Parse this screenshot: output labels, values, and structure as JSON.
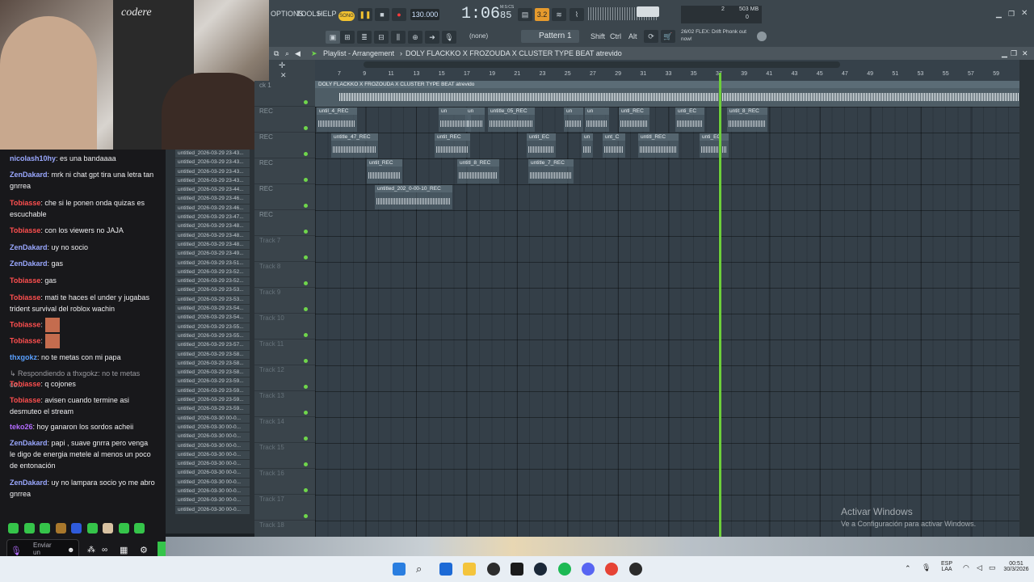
{
  "webcam": {
    "shirt_text": "codere"
  },
  "chat": {
    "messages": [
      {
        "user": "nicolash10hy",
        "color": "#9aa8ff",
        "text": ": es una bandaaaa"
      },
      {
        "user": "ZenDakard",
        "color": "#9aa8ff",
        "text": ": mrk ni chat gpt tira una letra tan gnrrea"
      },
      {
        "user": "Tobiasse",
        "color": "#ff4f4f",
        "text": ": che si le ponen onda quizas es escuchable"
      },
      {
        "user": "Tobiasse",
        "color": "#ff4f4f",
        "text": ": con los viewers no JAJA"
      },
      {
        "user": "ZenDakard",
        "color": "#9aa8ff",
        "text": ": uy no socio"
      },
      {
        "user": "ZenDakard",
        "color": "#9aa8ff",
        "text": ": gas"
      },
      {
        "user": "Tobiasse",
        "color": "#ff4f4f",
        "text": ": gas"
      },
      {
        "user": "Tobiasse",
        "color": "#ff4f4f",
        "text": ": mati te haces el under y jugabas trident survival del roblox wachin"
      },
      {
        "user": "Tobiasse",
        "color": "#ff4f4f",
        "text": ":"
      },
      {
        "user": "Tobiasse",
        "color": "#ff4f4f",
        "text": ":"
      },
      {
        "user": "thxgokz",
        "color": "#5aa0ff",
        "text": ": no te metas con mi papa"
      },
      {
        "user": "",
        "color": "#9a9aa0",
        "text": "↳ Respondiendo a thxgokz: no te metas co..."
      },
      {
        "user": "Tobiasse",
        "color": "#ff4f4f",
        "text": ": q cojones"
      },
      {
        "user": "Tobiasse",
        "color": "#ff4f4f",
        "text": ": avisen cuando termine asi desmuteo el stream"
      },
      {
        "user": "teko26",
        "color": "#b36cff",
        "text": ": hoy ganaron los sordos acheii"
      },
      {
        "user": "ZenDakard",
        "color": "#9aa8ff",
        "text": ": papi , suave gnrra pero venga le digo de energia metele al menos un poco de entonación"
      },
      {
        "user": "ZenDakard",
        "color": "#9aa8ff",
        "text": ": uy no lampara socio yo me abro gnrrea"
      }
    ],
    "send_label": "Enviar un mensaje"
  },
  "files": [
    "untitled_2026-03-29 23-43...",
    "untitled_2026-03-29 23-43...",
    "untitled_2026-03-29 23-43...",
    "untitled_2026-03-29 23-43...",
    "untitled_2026-03-29 23-44...",
    "untitled_2026-03-29 23-46...",
    "untitled_2026-03-29 23-46...",
    "untitled_2026-03-29 23-47...",
    "untitled_2026-03-29 23-48...",
    "untitled_2026-03-29 23-48...",
    "untitled_2026-03-29 23-48...",
    "untitled_2026-03-29 23-49...",
    "untitled_2026-03-29 23-51...",
    "untitled_2026-03-29 23-52...",
    "untitled_2026-03-29 23-52...",
    "untitled_2026-03-29 23-53...",
    "untitled_2026-03-29 23-53...",
    "untitled_2026-03-29 23-54...",
    "untitled_2026-03-29 23-54...",
    "untitled_2026-03-29 23-55...",
    "untitled_2026-03-29 23-55...",
    "untitled_2026-03-29 23-57...",
    "untitled_2026-03-29 23-58...",
    "untitled_2026-03-29 23-58...",
    "untitled_2026-03-29 23-58...",
    "untitled_2026-03-29 23-59...",
    "untitled_2026-03-29 23-59...",
    "untitled_2026-03-29 23-59...",
    "untitled_2026-03-29 23-59...",
    "untitled_2026-03-30 00-0...",
    "untitled_2026-03-30 00-0...",
    "untitled_2026-03-30 00-0...",
    "untitled_2026-03-30 00-0...",
    "untitled_2026-03-30 00-0...",
    "untitled_2026-03-30 00-0...",
    "untitled_2026-03-30 00-0...",
    "untitled_2026-03-30 00-0...",
    "untitled_2026-03-30 00-0...",
    "untitled_2026-03-30 00-0...",
    "untitled_2026-03-30 00-0..."
  ],
  "toolbar": {
    "menus": [
      "OPTIONS",
      "TOOLS",
      "HELP"
    ],
    "song_label": "SONG",
    "tempo": "130.000",
    "time": "1:06",
    "time_sub": "85",
    "time_unit": "M:S:CS",
    "beats": "3.2",
    "pattern": "Pattern 1",
    "none": "(none)",
    "mod_keys": [
      "Shift",
      "Ctrl",
      "Alt"
    ],
    "cpu_left": "2",
    "mem": "503 MB",
    "mem_sub": "0",
    "news": "26/02  FLEX: Drift Phonk out now!"
  },
  "playlist": {
    "title": "Playlist - Arrangement",
    "project": "DOLY FLACKKO X FROZOUDA X CLUSTER TYPE BEAT atrevido",
    "ruler": [
      "7",
      "9",
      "11",
      "13",
      "15",
      "17",
      "19",
      "21",
      "23",
      "25",
      "27",
      "29",
      "31",
      "33",
      "35",
      "37",
      "39",
      "41",
      "43",
      "45",
      "47",
      "49",
      "51",
      "53",
      "55",
      "57",
      "59"
    ],
    "tracks": [
      "ck 1",
      "REC",
      "REC",
      "REC",
      "REC",
      "REC",
      "Track 7",
      "Track 8",
      "Track 9",
      "Track 10",
      "Track 11",
      "Track 12",
      "Track 13",
      "Track 14",
      "Track 15",
      "Track 16",
      "Track 17",
      "Track 18"
    ],
    "master_clip": "DOLY FLACKKO X FROZOUDA X CLUSTER TYPE BEAT atrevido",
    "clips": [
      {
        "row": 1,
        "label": "until_4_REC"
      },
      {
        "row": 1,
        "label": "un"
      },
      {
        "row": 1,
        "label": "un"
      },
      {
        "row": 1,
        "label": "untitle_05_REC"
      },
      {
        "row": 1,
        "label": "un"
      },
      {
        "row": 1,
        "label": "un"
      },
      {
        "row": 1,
        "label": "untl_REC"
      },
      {
        "row": 1,
        "label": "unti_EC"
      },
      {
        "row": 1,
        "label": "untit_8_REC"
      },
      {
        "row": 2,
        "label": "untitle_47_REC"
      },
      {
        "row": 2,
        "label": "untit_REC"
      },
      {
        "row": 2,
        "label": "untit_EC"
      },
      {
        "row": 2,
        "label": "un"
      },
      {
        "row": 2,
        "label": "unt_C"
      },
      {
        "row": 2,
        "label": "untitl_REC"
      },
      {
        "row": 2,
        "label": "unti_EC"
      },
      {
        "row": 3,
        "label": "untit_REC"
      },
      {
        "row": 3,
        "label": "untitl_8_REC"
      },
      {
        "row": 3,
        "label": "untitle_7_REC"
      },
      {
        "row": 4,
        "label": "untitled_202_0-00-10_REC"
      }
    ]
  },
  "watermark": {
    "title": "Activar Windows",
    "subtitle": "Ve a Configuración para activar Windows."
  },
  "taskbar": {
    "lang": "ESP",
    "region": "LAA",
    "time": "00:51",
    "date": "30/3/2026"
  }
}
